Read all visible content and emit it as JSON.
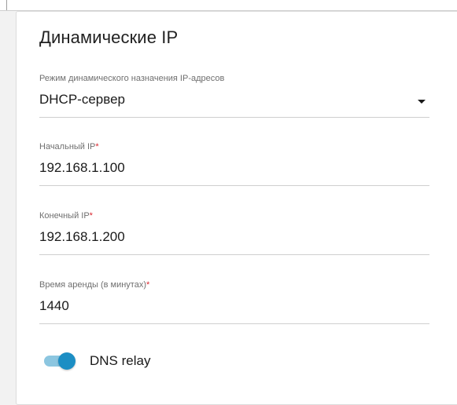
{
  "section": {
    "title": "Динамические IP"
  },
  "fields": {
    "mode": {
      "label": "Режим динамического назначения IP-адресов",
      "value": "DHCP-сервер",
      "icon": "chevron-down-icon"
    },
    "start_ip": {
      "label": "Начальный IP",
      "required_mark": "*",
      "value": "192.168.1.100"
    },
    "end_ip": {
      "label": "Конечный IP",
      "required_mark": "*",
      "value": "192.168.1.200"
    },
    "lease_time": {
      "label": "Время аренды (в минутах)",
      "required_mark": "*",
      "value": "1440"
    }
  },
  "dns_relay": {
    "label": "DNS relay",
    "enabled": true
  },
  "colors": {
    "accent": "#1c8ec4",
    "accent_track": "#8cc6e0",
    "required": "#d9262e"
  }
}
